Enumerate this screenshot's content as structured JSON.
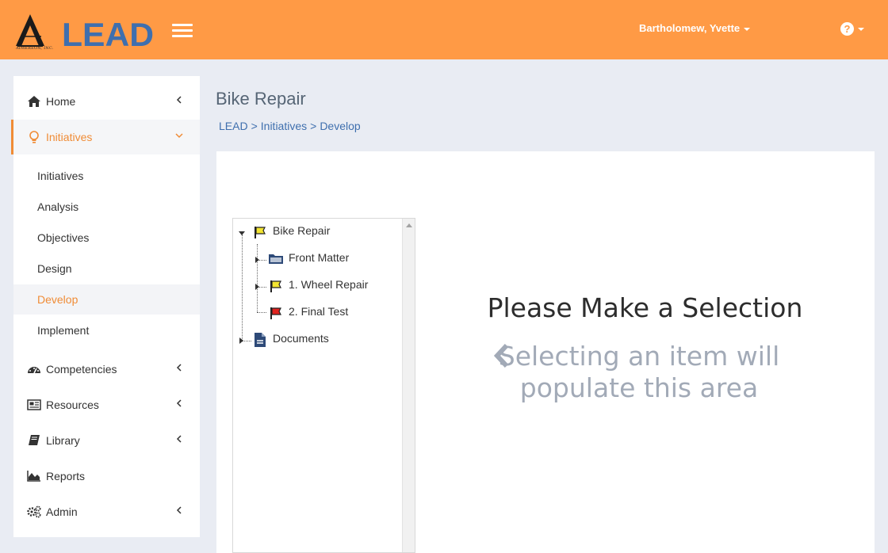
{
  "header": {
    "logo_text": "LEAD",
    "logo_subtext": "AIMEREON, INC.",
    "user_name": "Bartholomew, Yvette",
    "help_symbol": "?",
    "bg_color": "#ff9a45"
  },
  "sidebar": {
    "items": [
      {
        "label": "Home",
        "icon": "home-icon"
      },
      {
        "label": "Initiatives",
        "icon": "lightbulb-icon"
      },
      {
        "label": "Competencies",
        "icon": "dashboard-icon"
      },
      {
        "label": "Resources",
        "icon": "newspaper-icon"
      },
      {
        "label": "Library",
        "icon": "book-icon"
      },
      {
        "label": "Reports",
        "icon": "area-chart-icon"
      },
      {
        "label": "Admin",
        "icon": "gears-icon"
      }
    ],
    "subitems": [
      {
        "label": "Initiatives"
      },
      {
        "label": "Analysis"
      },
      {
        "label": "Objectives"
      },
      {
        "label": "Design"
      },
      {
        "label": "Develop"
      },
      {
        "label": "Implement"
      }
    ],
    "accent_color": "#f08c36"
  },
  "main": {
    "title": "Bike Repair",
    "breadcrumb": [
      "LEAD",
      "Initiatives",
      "Develop"
    ],
    "breadcrumb_sep": ">"
  },
  "tree": {
    "nodes": [
      {
        "label": "Bike Repair",
        "icon": "yellow-flag-icon",
        "expanded": true
      },
      {
        "label": "Front Matter",
        "icon": "folder-icon"
      },
      {
        "label": "1. Wheel Repair",
        "icon": "yellow-flag-icon"
      },
      {
        "label": "2. Final Test",
        "icon": "red-flag-icon"
      },
      {
        "label": "Documents",
        "icon": "document-icon"
      }
    ]
  },
  "message": {
    "title": "Please Make a Selection",
    "subtitle": "Selecting an item will populate this area"
  }
}
